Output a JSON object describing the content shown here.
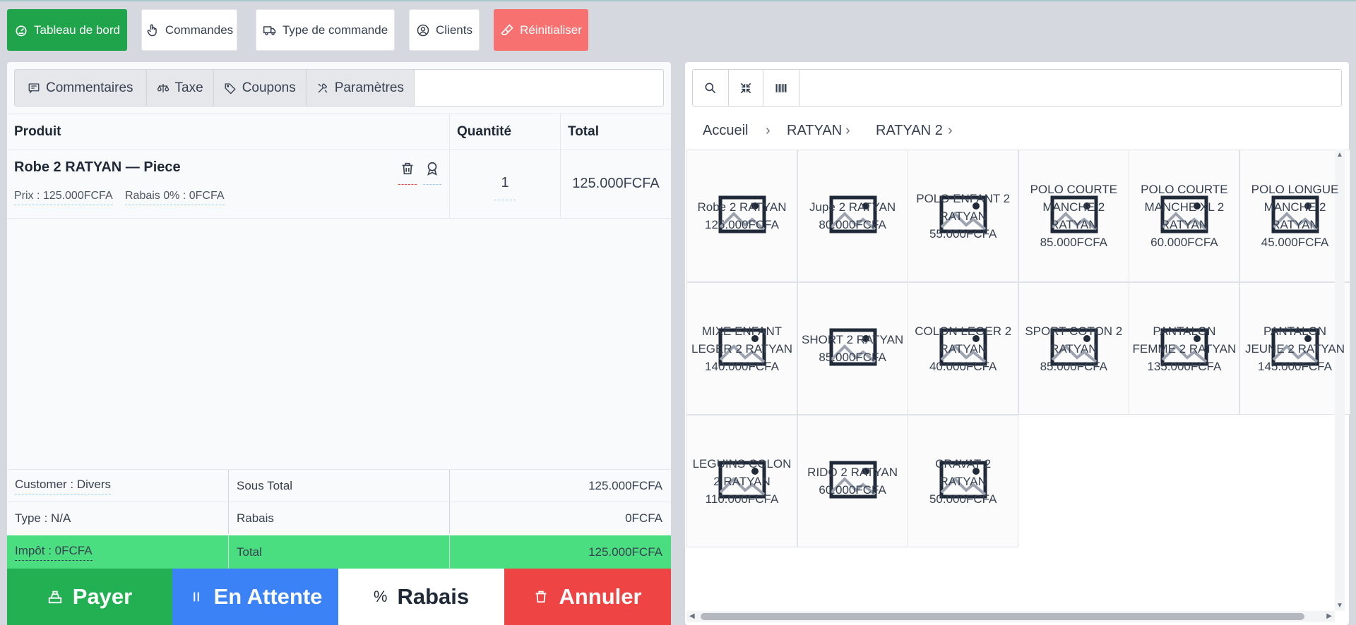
{
  "topnav": {
    "dashboard": "Tableau de bord",
    "orders": "Commandes",
    "order_type": "Type de commande",
    "clients": "Clients",
    "reset": "Réinitialiser"
  },
  "cart_tabs": [
    "Commentaires",
    "Taxe",
    "Coupons",
    "Paramètres"
  ],
  "cart_table": {
    "headers": {
      "product": "Produit",
      "quantity": "Quantité",
      "total": "Total"
    },
    "rows": [
      {
        "name": "Robe 2 RATYAN — Piece",
        "price": "Prix : 125.000FCFA",
        "discount": "Rabais 0% : 0FCFA",
        "quantity": "1",
        "total": "125.000FCFA"
      }
    ]
  },
  "summary": {
    "customer": "Customer : Divers",
    "subtotal_label": "Sous Total",
    "subtotal": "125.000FCFA",
    "type": "Type : N/A",
    "discount_label": "Rabais",
    "discount": "0FCFA",
    "tax": "Impôt : 0FCFA",
    "total_label": "Total",
    "total": "125.000FCFA"
  },
  "actions": {
    "pay": "Payer",
    "hold": "En Attente",
    "discount": "Rabais",
    "cancel": "Annuler"
  },
  "breadcrumb": [
    "Accueil",
    "RATYAN",
    "RATYAN 2"
  ],
  "products": [
    {
      "name": "Robe 2 RATYAN",
      "price": "125.000FCFA"
    },
    {
      "name": "Jupe 2 RATYAN",
      "price": "80.000FCFA"
    },
    {
      "name": "POLO ENFANT 2 RATYAN",
      "price": "55.000FCFA"
    },
    {
      "name": "POLO COURTE MANCHE 2 RATYAN",
      "price": "85.000FCFA"
    },
    {
      "name": "POLO COURTE MANCHE XL 2 RATYAN",
      "price": "60.000FCFA"
    },
    {
      "name": "POLO LONGUE MANCHE 2 RATYAN",
      "price": "45.000FCFA"
    },
    {
      "name": "MIXE ENFANT LEGER 2 RATYAN",
      "price": "140.000FCFA"
    },
    {
      "name": "SHORT 2 RATYAN",
      "price": "85.000FCFA"
    },
    {
      "name": "COLON LEGER 2 RATYAN",
      "price": "40.000FCFA"
    },
    {
      "name": "SPORT COTON 2 RATYAN",
      "price": "85.000FCFA"
    },
    {
      "name": "PANTALON FEMME 2 RATYAN",
      "price": "135.000FCFA"
    },
    {
      "name": "PANTALON JEUNE 2 RATYAN",
      "price": "145.000FCFA"
    },
    {
      "name": "LEGUINS COLON 2 RATYAN",
      "price": "110.000FCFA"
    },
    {
      "name": "RIDO 2 RATYAN",
      "price": "60.000FCFA"
    },
    {
      "name": "CRAVAT 2 RATYAN",
      "price": "50.000FCFA"
    }
  ],
  "colors": {
    "dashboard_bg": "#1fa34b",
    "reset_bg": "#f87171",
    "pay_bg": "#22b053",
    "hold_bg": "#3b82f6",
    "cancel_bg": "#ef4444",
    "tax_row_bg": "#4ade80"
  }
}
